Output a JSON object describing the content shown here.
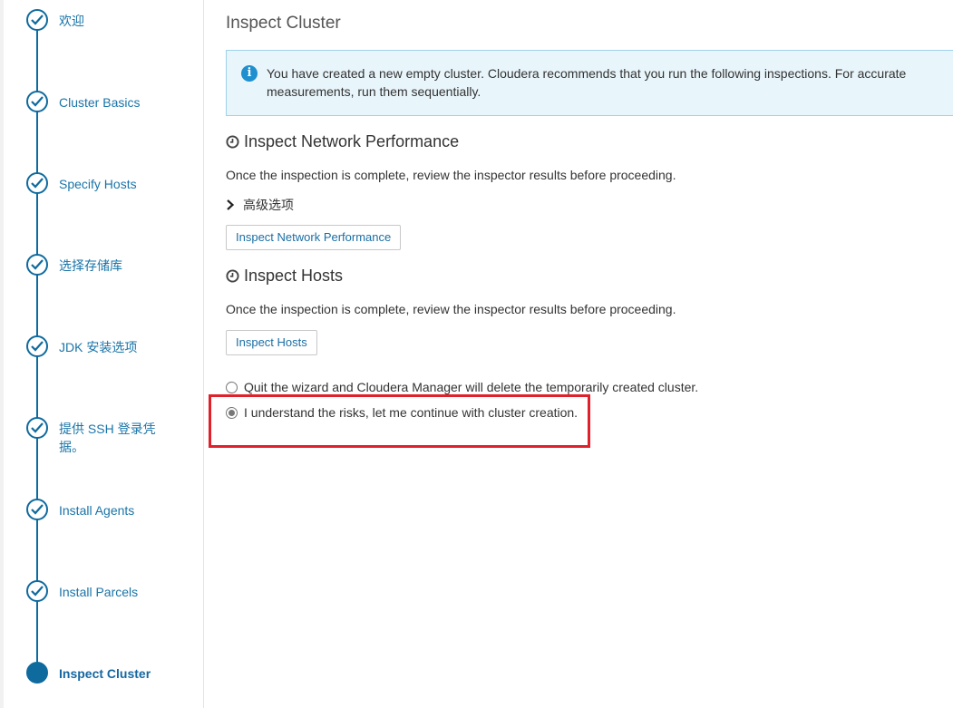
{
  "sidebar": {
    "steps": [
      {
        "label": "欢迎",
        "state": "done"
      },
      {
        "label": "Cluster Basics",
        "state": "done"
      },
      {
        "label": "Specify Hosts",
        "state": "done"
      },
      {
        "label": "选择存储库",
        "state": "done"
      },
      {
        "label": "JDK 安装选项",
        "state": "done"
      },
      {
        "label": "提供 SSH 登录凭据。",
        "state": "done"
      },
      {
        "label": "Install Agents",
        "state": "done"
      },
      {
        "label": "Install Parcels",
        "state": "done"
      },
      {
        "label": "Inspect Cluster",
        "state": "current"
      }
    ]
  },
  "main": {
    "title": "Inspect Cluster",
    "info_text": "You have created a new empty cluster. Cloudera recommends that you run the following inspections. For accurate measurements, run them sequentially.",
    "network": {
      "title": "Inspect Network Performance",
      "description": "Once the inspection is complete, review the inspector results before proceeding.",
      "advanced_label": "高级选项",
      "button_label": "Inspect Network Performance"
    },
    "hosts": {
      "title": "Inspect Hosts",
      "description": "Once the inspection is complete, review the inspector results before proceeding.",
      "button_label": "Inspect Hosts"
    },
    "options": [
      {
        "label": "Quit the wizard and Cloudera Manager will delete the temporarily created cluster.",
        "checked": false
      },
      {
        "label": "I understand the risks, let me continue with cluster creation.",
        "checked": true
      }
    ]
  },
  "colors": {
    "accent": "#0f6a9e",
    "highlight": "#e0212b",
    "info_bg": "#e8f5fb"
  }
}
